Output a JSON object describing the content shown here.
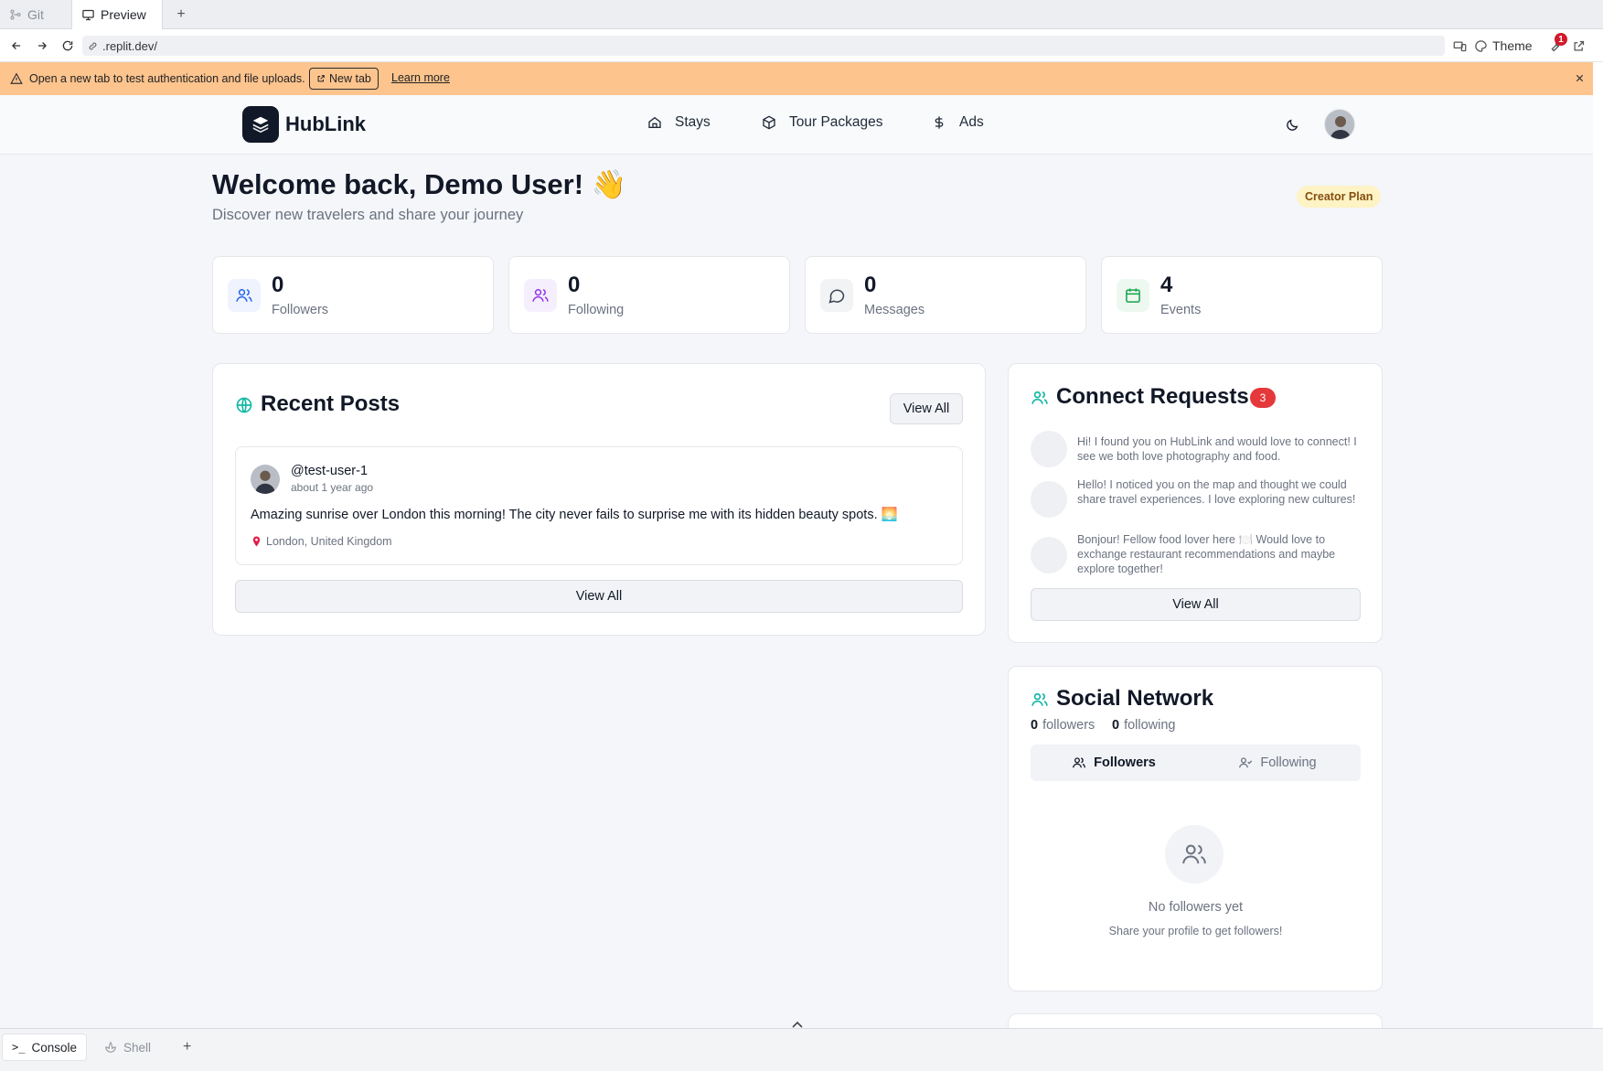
{
  "ide": {
    "tabs": [
      {
        "label": "Git",
        "icon": "git-branch-icon",
        "active": false
      },
      {
        "label": "Preview",
        "icon": "monitor-icon",
        "active": true
      }
    ],
    "url": ".replit.dev/",
    "theme_label": "Theme",
    "notification_count": "1",
    "bottom_tabs": [
      {
        "label": "Console",
        "icon": "terminal-icon",
        "active": true
      },
      {
        "label": "Shell",
        "icon": "shell-icon",
        "active": false
      }
    ]
  },
  "banner": {
    "message": "Open a new tab to test authentication and file uploads.",
    "new_tab_label": "New tab",
    "learn_more_label": "Learn more",
    "color": "#fdc48e"
  },
  "app": {
    "brand": "HubLink",
    "nav": [
      {
        "label": "Stays",
        "icon": "home-icon"
      },
      {
        "label": "Tour Packages",
        "icon": "package-icon"
      },
      {
        "label": "Ads",
        "icon": "dollar-icon"
      }
    ],
    "welcome": "Welcome back, Demo User! 👋",
    "subtitle": "Discover new travelers and share your journey",
    "plan_badge": "Creator Plan",
    "stats": [
      {
        "value": "0",
        "label": "Followers",
        "icon": "users-icon",
        "color": "#2563eb"
      },
      {
        "value": "0",
        "label": "Following",
        "icon": "users-icon",
        "color": "#9333ea"
      },
      {
        "value": "0",
        "label": "Messages",
        "icon": "message-icon",
        "color": "#374151"
      },
      {
        "value": "4",
        "label": "Events",
        "icon": "calendar-icon",
        "color": "#16a34a"
      }
    ],
    "recent_posts": {
      "title": "Recent Posts",
      "view_all_top": "View All",
      "view_all_bottom": "View All",
      "posts": [
        {
          "username": "@test-user-1",
          "time": "about 1 year ago",
          "content": "Amazing sunrise over London this morning! The city never fails to surprise me with its hidden beauty spots. 🌅",
          "location": "London, United Kingdom"
        }
      ]
    },
    "connect_requests": {
      "title": "Connect Requests",
      "count": "3",
      "view_all": "View All",
      "requests": [
        {
          "message": "Hi! I found you on HubLink and would love to connect! I see we both love photography and food."
        },
        {
          "message": "Hello! I noticed you on the map and thought we could share travel experiences. I love exploring new cultures!"
        },
        {
          "message": "Bonjour! Fellow food lover here 🍽️ Would love to exchange restaurant recommendations and maybe explore together!"
        }
      ]
    },
    "social_network": {
      "title": "Social Network",
      "followers_count": "0",
      "followers_word": "followers",
      "following_count": "0",
      "following_word": "following",
      "tab_followers": "Followers",
      "tab_following": "Following",
      "empty_title": "No followers yet",
      "empty_subtitle": "Share your profile to get followers!"
    },
    "accent_color": "#14b8a6"
  }
}
